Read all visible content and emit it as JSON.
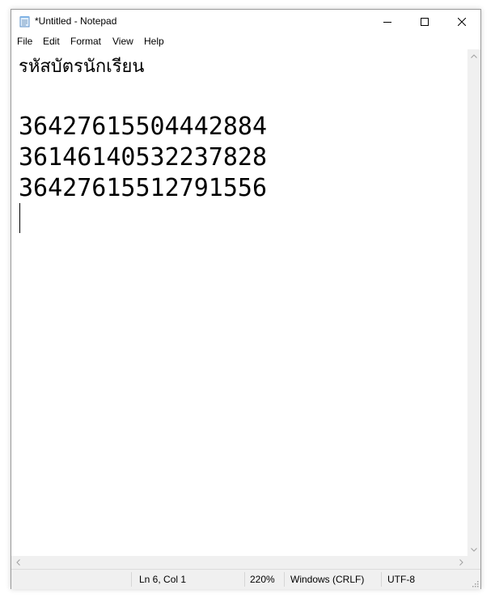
{
  "window": {
    "title": "*Untitled - Notepad"
  },
  "menu": {
    "items": [
      "File",
      "Edit",
      "Format",
      "View",
      "Help"
    ]
  },
  "editor": {
    "lines": [
      "รหัสบัตรนักเรียน",
      "",
      "36427615504442884",
      "36146140532237828",
      "36427615512791556",
      ""
    ]
  },
  "status": {
    "position": "Ln 6, Col 1",
    "zoom": "220%",
    "line_endings": "Windows (CRLF)",
    "encoding": "UTF-8"
  },
  "icons": {
    "app": "notepad-icon",
    "minimize": "minimize-icon",
    "maximize": "maximize-icon",
    "close": "close-icon"
  }
}
